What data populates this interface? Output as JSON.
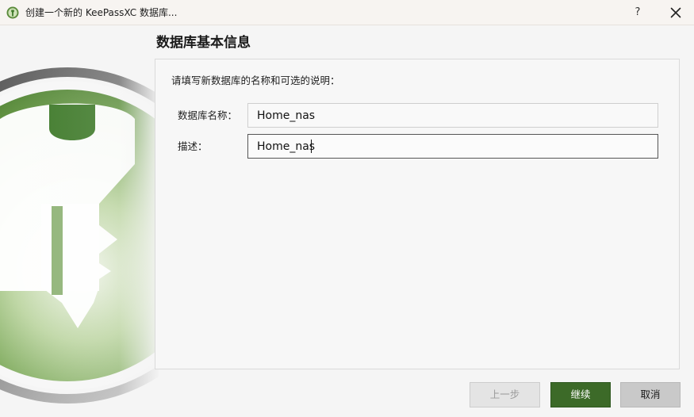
{
  "window": {
    "title": "创建一个新的 KeePassXC 数据库...",
    "help_label": "?",
    "app_icon": "keepassxc-logo-icon",
    "close_icon": "close-icon"
  },
  "page": {
    "heading": "数据库基本信息"
  },
  "form": {
    "description": "请填写新数据库的名称和可选的说明：",
    "name_label": "数据库名称：",
    "name_value": "Home_nas",
    "desc_label": "描述：",
    "desc_value": "Home_nas"
  },
  "buttons": {
    "back_label": "上一步",
    "next_label": "继续",
    "cancel_label": "取消"
  },
  "colors": {
    "accent": "#3c6a28",
    "logo_green_dark": "#3f7a2a",
    "logo_green_light": "#a9c98a"
  }
}
